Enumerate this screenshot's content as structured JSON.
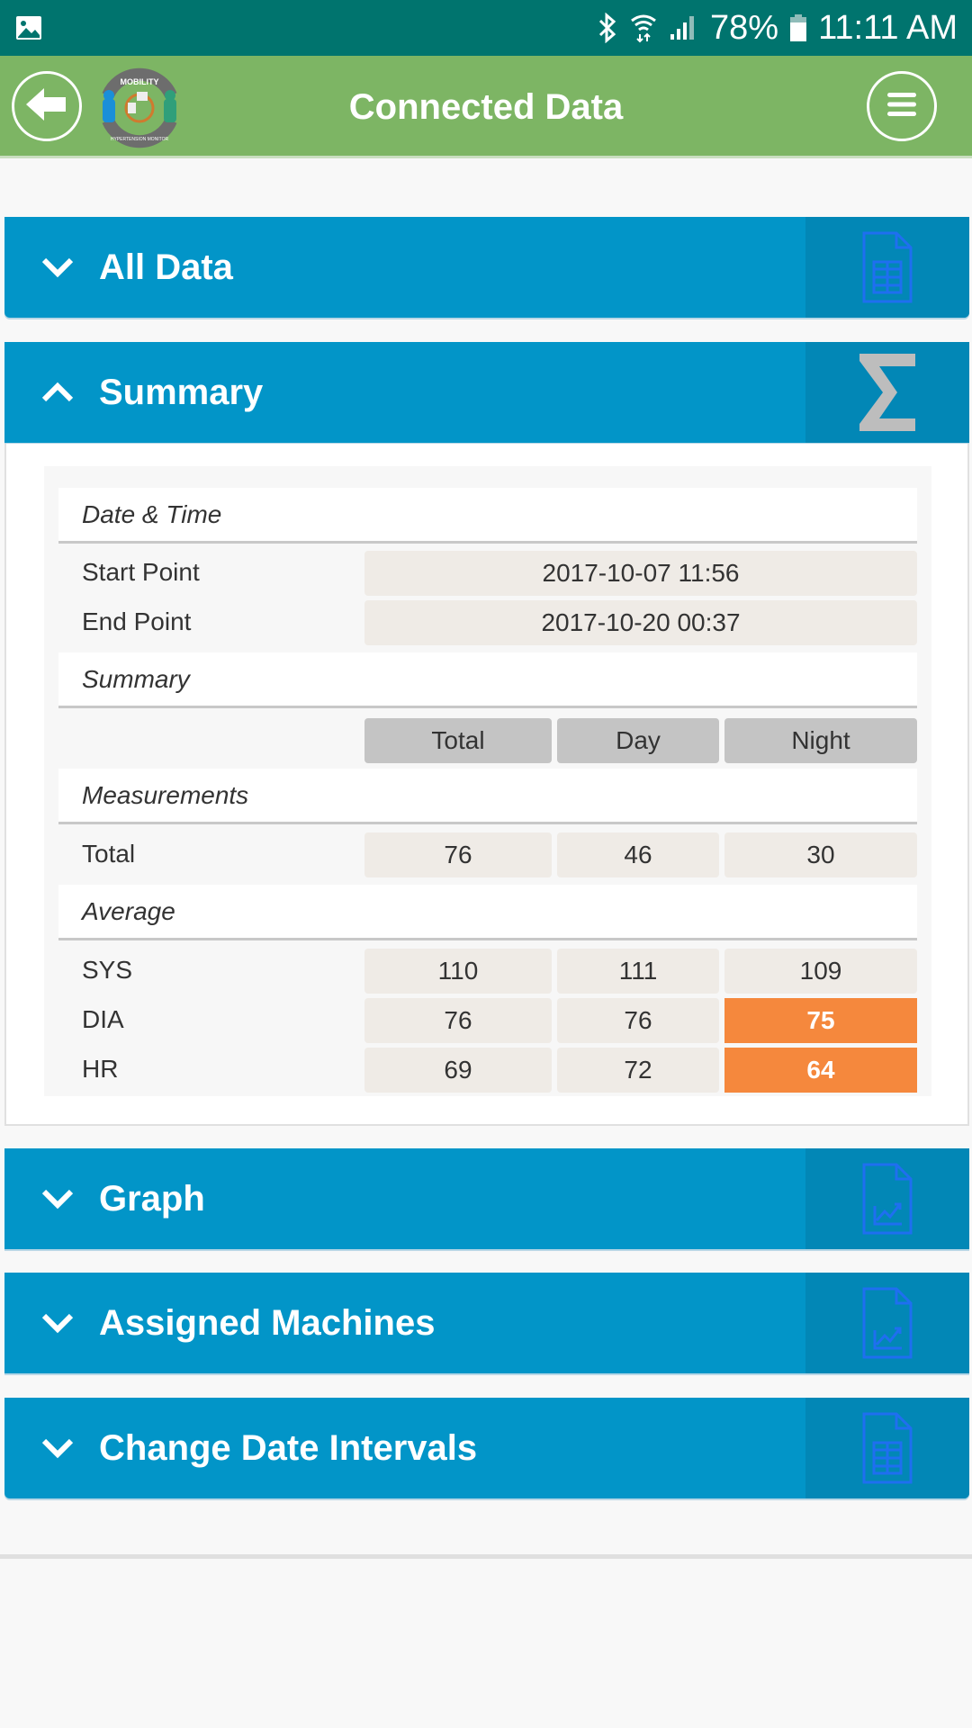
{
  "status_bar": {
    "battery": "78%",
    "time": "11:11 AM",
    "icons": [
      "image-notification-icon",
      "bluetooth-icon",
      "wifi-icon",
      "signal-icon",
      "battery-icon"
    ]
  },
  "app_bar": {
    "title": "Connected Data",
    "logo_top_text": "MOBILITY",
    "logo_bottom_text": "HYPERTENSION MONITOR",
    "back_icon": "arrow-left-icon",
    "menu_icon": "hamburger-menu-icon"
  },
  "sections": [
    {
      "label": "All Data",
      "expanded": false,
      "icon": "spreadsheet-file-icon"
    },
    {
      "label": "Summary",
      "expanded": true,
      "icon": "sigma-icon"
    },
    {
      "label": "Graph",
      "expanded": false,
      "icon": "chart-file-icon"
    },
    {
      "label": "Assigned Machines",
      "expanded": false,
      "icon": "chart-file-icon"
    },
    {
      "label": "Change Date Intervals",
      "expanded": false,
      "icon": "spreadsheet-file-icon"
    }
  ],
  "summary": {
    "date_time": {
      "heading": "Date & Time",
      "start_label": "Start Point",
      "start_value": "2017-10-07 11:56",
      "end_label": "End Point",
      "end_value": "2017-10-20 00:37"
    },
    "summary_heading": "Summary",
    "columns": [
      "Total",
      "Day",
      "Night"
    ],
    "measurements": {
      "heading": "Measurements",
      "rows": [
        {
          "label": "Total",
          "values": [
            "76",
            "46",
            "30"
          ],
          "alerts": [
            false,
            false,
            false
          ]
        }
      ]
    },
    "average": {
      "heading": "Average",
      "rows": [
        {
          "label": "SYS",
          "values": [
            "110",
            "111",
            "109"
          ],
          "alerts": [
            false,
            false,
            false
          ]
        },
        {
          "label": "DIA",
          "values": [
            "76",
            "76",
            "75"
          ],
          "alerts": [
            false,
            false,
            true
          ]
        },
        {
          "label": "HR",
          "values": [
            "69",
            "72",
            "64"
          ],
          "alerts": [
            false,
            false,
            true
          ]
        }
      ]
    }
  },
  "colors": {
    "status_bar": "#00746e",
    "app_bar": "#7db564",
    "section_header": "#0295c8",
    "section_icon_area": "#0287b6",
    "alert": "#f5883d",
    "cell": "#efebe6",
    "column_header": "#c4c4c4"
  }
}
